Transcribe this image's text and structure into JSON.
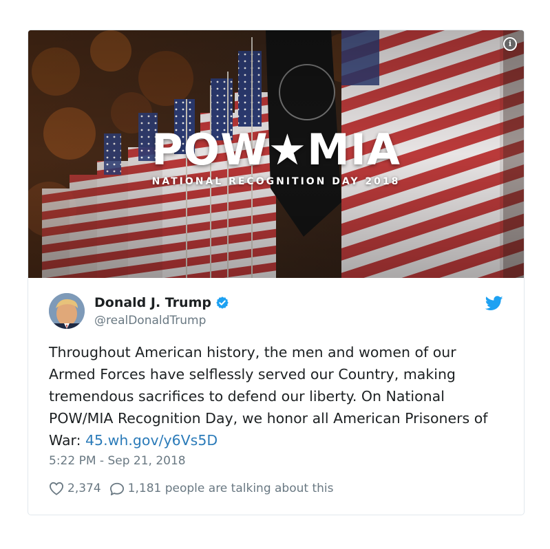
{
  "media": {
    "headline": "POW★MIA",
    "subheadline": "NATIONAL RECOGNITION DAY 2018",
    "info_icon": "info-icon"
  },
  "author": {
    "name": "Donald J. Trump",
    "handle": "@realDonaldTrump",
    "verified_icon": "verified-badge-icon",
    "platform_icon": "twitter-bird-icon"
  },
  "tweet": {
    "text": "Throughout American history, the men and women of our Armed Forces have selflessly served our Country, making tremendous sacrifices to defend our liberty. On National POW/MIA Recognition Day, we honor all American Prisoners of War: ",
    "link": "45.wh.gov/y6Vs5D",
    "timestamp": "5:22 PM - Sep 21, 2018"
  },
  "actions": {
    "likes": "2,374",
    "talking": "1,181 people are talking about this"
  },
  "colors": {
    "link": "#2b7bb9",
    "verified": "#1da1f2",
    "muted": "#697882"
  }
}
